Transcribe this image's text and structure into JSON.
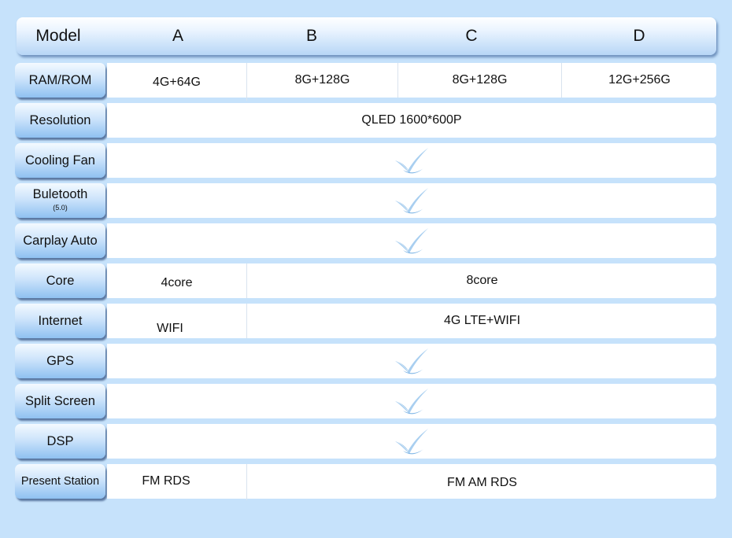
{
  "header": {
    "model_label": "Model",
    "columns": [
      "A",
      "B",
      "C",
      "D"
    ]
  },
  "rows": {
    "ram_rom": {
      "label": "RAM/ROM",
      "values": [
        "4G+64G",
        "8G+128G",
        "8G+128G",
        "12G+256G"
      ]
    },
    "resolution": {
      "label": "Resolution",
      "value": "QLED 1600*600P"
    },
    "cooling_fan": {
      "label": "Cooling Fan",
      "value": "check"
    },
    "bluetooth": {
      "label": "Buletooth",
      "sublabel": "(5.0)",
      "value": "check"
    },
    "carplay": {
      "label": "Carplay Auto",
      "value": "check"
    },
    "core": {
      "label": "Core",
      "values": [
        "4core",
        "8core"
      ]
    },
    "internet": {
      "label": "Internet",
      "values": [
        "WIFI",
        "4G LTE+WIFI"
      ]
    },
    "gps": {
      "label": "GPS",
      "value": "check"
    },
    "split_screen": {
      "label": "Split Screen",
      "value": "check"
    },
    "dsp": {
      "label": "DSP",
      "value": "check"
    },
    "present_station": {
      "label": "Present Station",
      "values": [
        "FM RDS",
        "FM AM RDS"
      ]
    }
  },
  "colors": {
    "background": "#c6e2fb",
    "check_light": "#a9cff0",
    "check_dark": "#5d9fd8"
  }
}
